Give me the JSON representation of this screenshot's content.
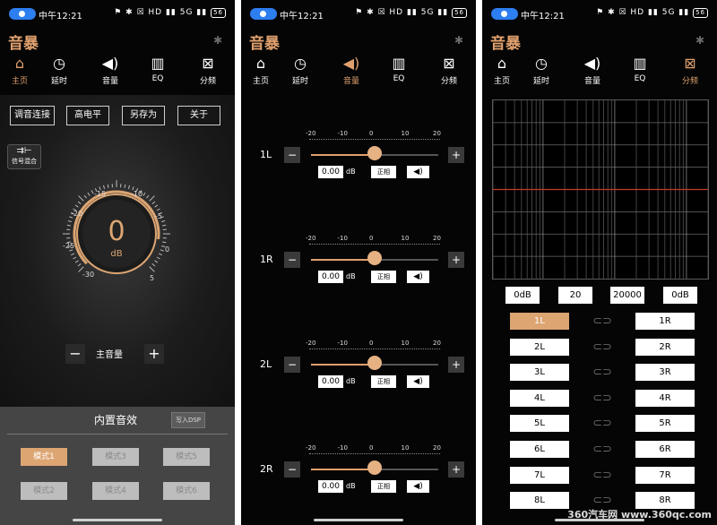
{
  "status": {
    "time": "中午12:21",
    "icons": "⚑ ✱ ☒ HD ▮▮ 5G ▮▮",
    "battery": "56"
  },
  "app": {
    "title": "音暴"
  },
  "tabs": [
    {
      "label": "主页",
      "icon": "home-icon"
    },
    {
      "label": "延时",
      "icon": "clock-icon"
    },
    {
      "label": "音量",
      "icon": "speaker-icon"
    },
    {
      "label": "EQ",
      "icon": "equalizer-icon"
    },
    {
      "label": "分频",
      "icon": "crossover-icon"
    }
  ],
  "home": {
    "buttons": [
      "调音连接",
      "高电平",
      "另存为",
      "关于"
    ],
    "mix_label": "信号混合",
    "knob": {
      "value": "0",
      "unit": "dB",
      "ticks": [
        "-30",
        "-25",
        "-20",
        "-15",
        "-10",
        "-5",
        "0",
        "5"
      ],
      "level_fraction": 0.86
    },
    "master_label": "主音量",
    "minus": "−",
    "plus": "+",
    "preset_title": "内置音效",
    "write_dsp": "写入DSP",
    "presets": [
      "模式1",
      "模式3",
      "模式5",
      "模式2",
      "模式4",
      "模式6"
    ],
    "selected_preset": "模式1"
  },
  "volume": {
    "scale": [
      "-20",
      "-10",
      "0",
      "10",
      "20"
    ],
    "unit": "dB",
    "phase_label": "正相",
    "speaker_icon": "speaker-icon",
    "channels": [
      {
        "label": "1L",
        "value": "0.00",
        "level": 0
      },
      {
        "label": "1R",
        "value": "0.00",
        "level": 0
      },
      {
        "label": "2L",
        "value": "0.00",
        "level": 0
      },
      {
        "label": "2R",
        "value": "0.00",
        "level": 0
      }
    ]
  },
  "crossover": {
    "fields": [
      "0dB",
      "20",
      "20000",
      "0dB"
    ],
    "left": [
      "1L",
      "2L",
      "3L",
      "4L",
      "5L",
      "6L",
      "7L",
      "8L"
    ],
    "right": [
      "1R",
      "2R",
      "3R",
      "4R",
      "5R",
      "6R",
      "7R",
      "8R"
    ],
    "selected": "1L",
    "curve_color": "#c0392b"
  },
  "watermark": "360汽车网 www.360qc.com",
  "colors": {
    "accent": "#e0a06e",
    "pin": "#2d7ef0"
  }
}
